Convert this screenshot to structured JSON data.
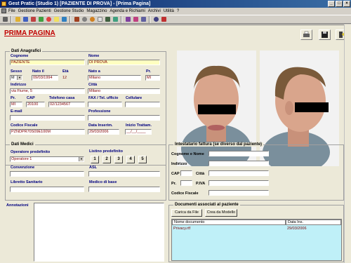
{
  "window": {
    "title": "Gest Pratic (Studio 1) [PAZIENTE DI PROVA] - [Prima Pagina]"
  },
  "menu": [
    "File",
    "Gestione Pazienti",
    "Gestione Studio",
    "Magazzino",
    "Agenda e Richiami",
    "Archivi",
    "Utilità",
    "?"
  ],
  "toolbar_icons": [
    "printer-icon",
    "folder-icon",
    "grid-icon",
    "calendar-icon",
    "money-icon",
    "lifebuoy-icon",
    "note-icon",
    "card-icon",
    "bag-icon",
    "clock-icon",
    "camera-icon",
    "tooth-icon",
    "calc-icon",
    "doc-icon",
    "phone-icon",
    "chart-icon",
    "settings-icon",
    "search-icon",
    "exit-icon"
  ],
  "page": {
    "title": "PRIMA PAGINA"
  },
  "anagrafici": {
    "title": "Dati Anagrafici",
    "cognome_label": "Cognome",
    "cognome": "PAZIENTE",
    "nome_label": "Nome",
    "nome": "DI PROVA",
    "sesso_label": "Sesso",
    "sesso": "M",
    "nato_il_label": "Nato il",
    "nato_il": "09/03/1994",
    "eta_label": "Età",
    "eta": "12",
    "nato_a_label": "Nato a",
    "nato_a": "Milano",
    "pr_label": "Pr.",
    "pr_nascita": "MI",
    "indirizzo_label": "Indirizzo",
    "indirizzo": "via Fiume, 5",
    "citta_label": "Città",
    "citta": "Milano",
    "pr2_label": "Pr.",
    "pr": "MI",
    "cap_label": "CAP",
    "cap": "20100",
    "telefono_label": "Telefono casa",
    "telefono": "02/1234567",
    "fax_label": "FAX / Tel. ufficio",
    "fax": "",
    "cellulare_label": "Cellulare",
    "cellulare": "",
    "email_label": "E-mail",
    "email": "",
    "professione_label": "Professione",
    "professione": "",
    "cf_label": "Codice Fiscale",
    "cf": "PZNDPR70S09E100M",
    "data_inserim_label": "Data Inserim.",
    "data_inserim": "29/03/2006",
    "inizio_tratt_label": "Inizio Trattam.",
    "inizio_tratt": "__/__/____"
  },
  "medici": {
    "title": "Dati Medici",
    "operatore_label": "Operatore predefinito",
    "operatore": "Operatore 1",
    "listino_label": "Listino predefinito",
    "listino": [
      "1",
      "2",
      "3",
      "4",
      "5"
    ],
    "convenzione_label": "Convenzione",
    "convenzione": "",
    "asl_label": "ASL",
    "asl": "",
    "libretto_label": "Libretto Sanitario",
    "libretto": "",
    "medico_label": "Medico di base",
    "medico": ""
  },
  "fattura": {
    "title": "Intestatario fattura (se diverso dal paziente)",
    "nome_label": "Cognome e Nome",
    "indirizzo_label": "Indirizzo",
    "cap_label": "CAP",
    "citta_label": "Città",
    "pr_label": "Pr.",
    "piva_label": "P.IVA",
    "cf_label": "Codice Fiscale"
  },
  "annotazioni": {
    "title": "Annotazioni"
  },
  "documenti": {
    "title": "Documenti associati al paziente",
    "carica_btn": "Carica da File",
    "crea_btn": "Crea da Modello",
    "col_nome": "Nome documento",
    "col_data": "Data Ins.",
    "rows": [
      {
        "nome": "Privacy.rtf",
        "data": "29/03/2006"
      }
    ]
  }
}
